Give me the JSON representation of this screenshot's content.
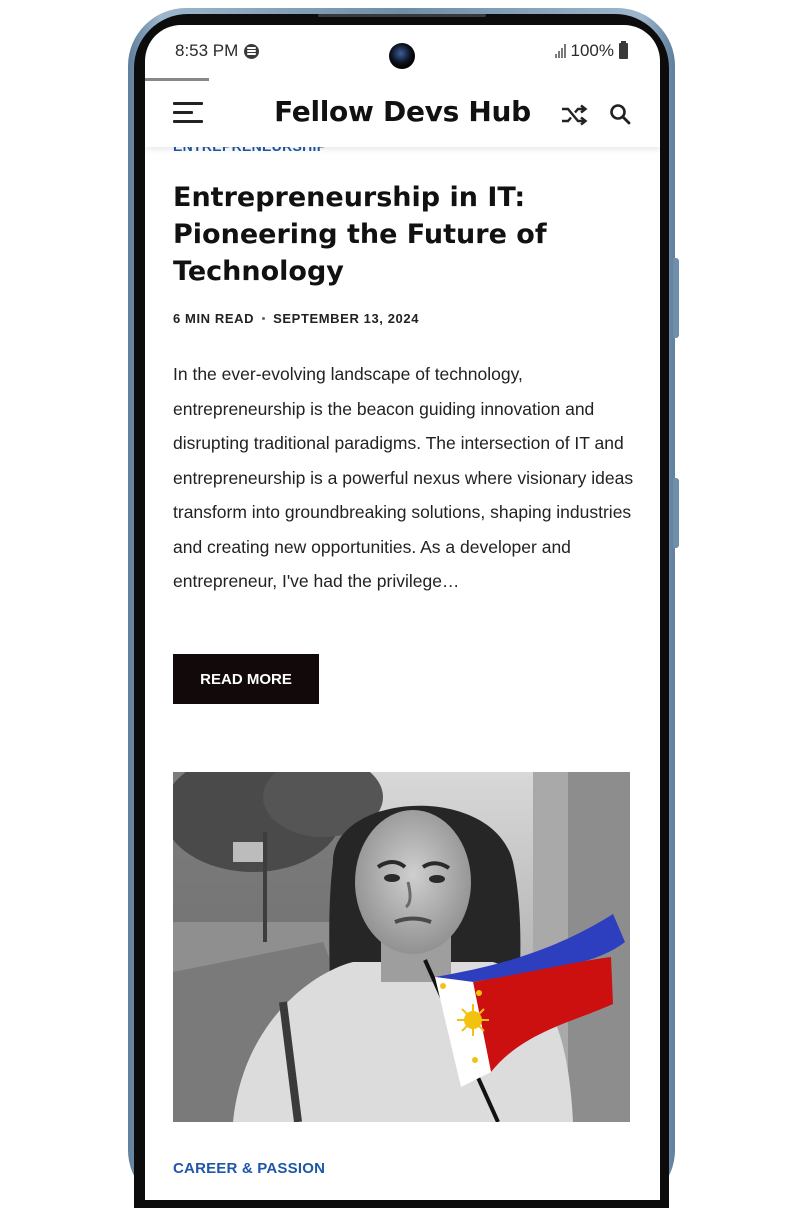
{
  "status_bar": {
    "time": "8:53 PM",
    "battery": "100%"
  },
  "header": {
    "site_title": "Fellow Devs Hub",
    "menu_icon": "hamburger-menu-icon",
    "shuffle_icon": "shuffle-icon",
    "search_icon": "search-icon"
  },
  "post": {
    "category": "ENTREPRENEURSHIP",
    "title": "Entrepreneurship in IT: Pioneering the Future of Technology",
    "read_time": "6 MIN READ",
    "date": "SEPTEMBER 13, 2024",
    "excerpt": "In the ever-evolving landscape of technology, entrepreneurship is the beacon guiding innovation and disrupting traditional paradigms. The intersection of IT and entrepreneurship is a powerful nexus where visionary ideas transform into groundbreaking solutions, shaping industries and creating new opportunities. As a developer and entrepreneur, I've had the privilege…",
    "read_more": "READ MORE"
  },
  "next_post": {
    "category": "CAREER & PASSION"
  },
  "colors": {
    "accent": "#1f57a8",
    "button_bg": "#120a0a",
    "phone_frame": "#7d9bb6",
    "flag_blue": "#2d3fbf",
    "flag_red": "#cc1010",
    "flag_yellow": "#f3c20f"
  }
}
